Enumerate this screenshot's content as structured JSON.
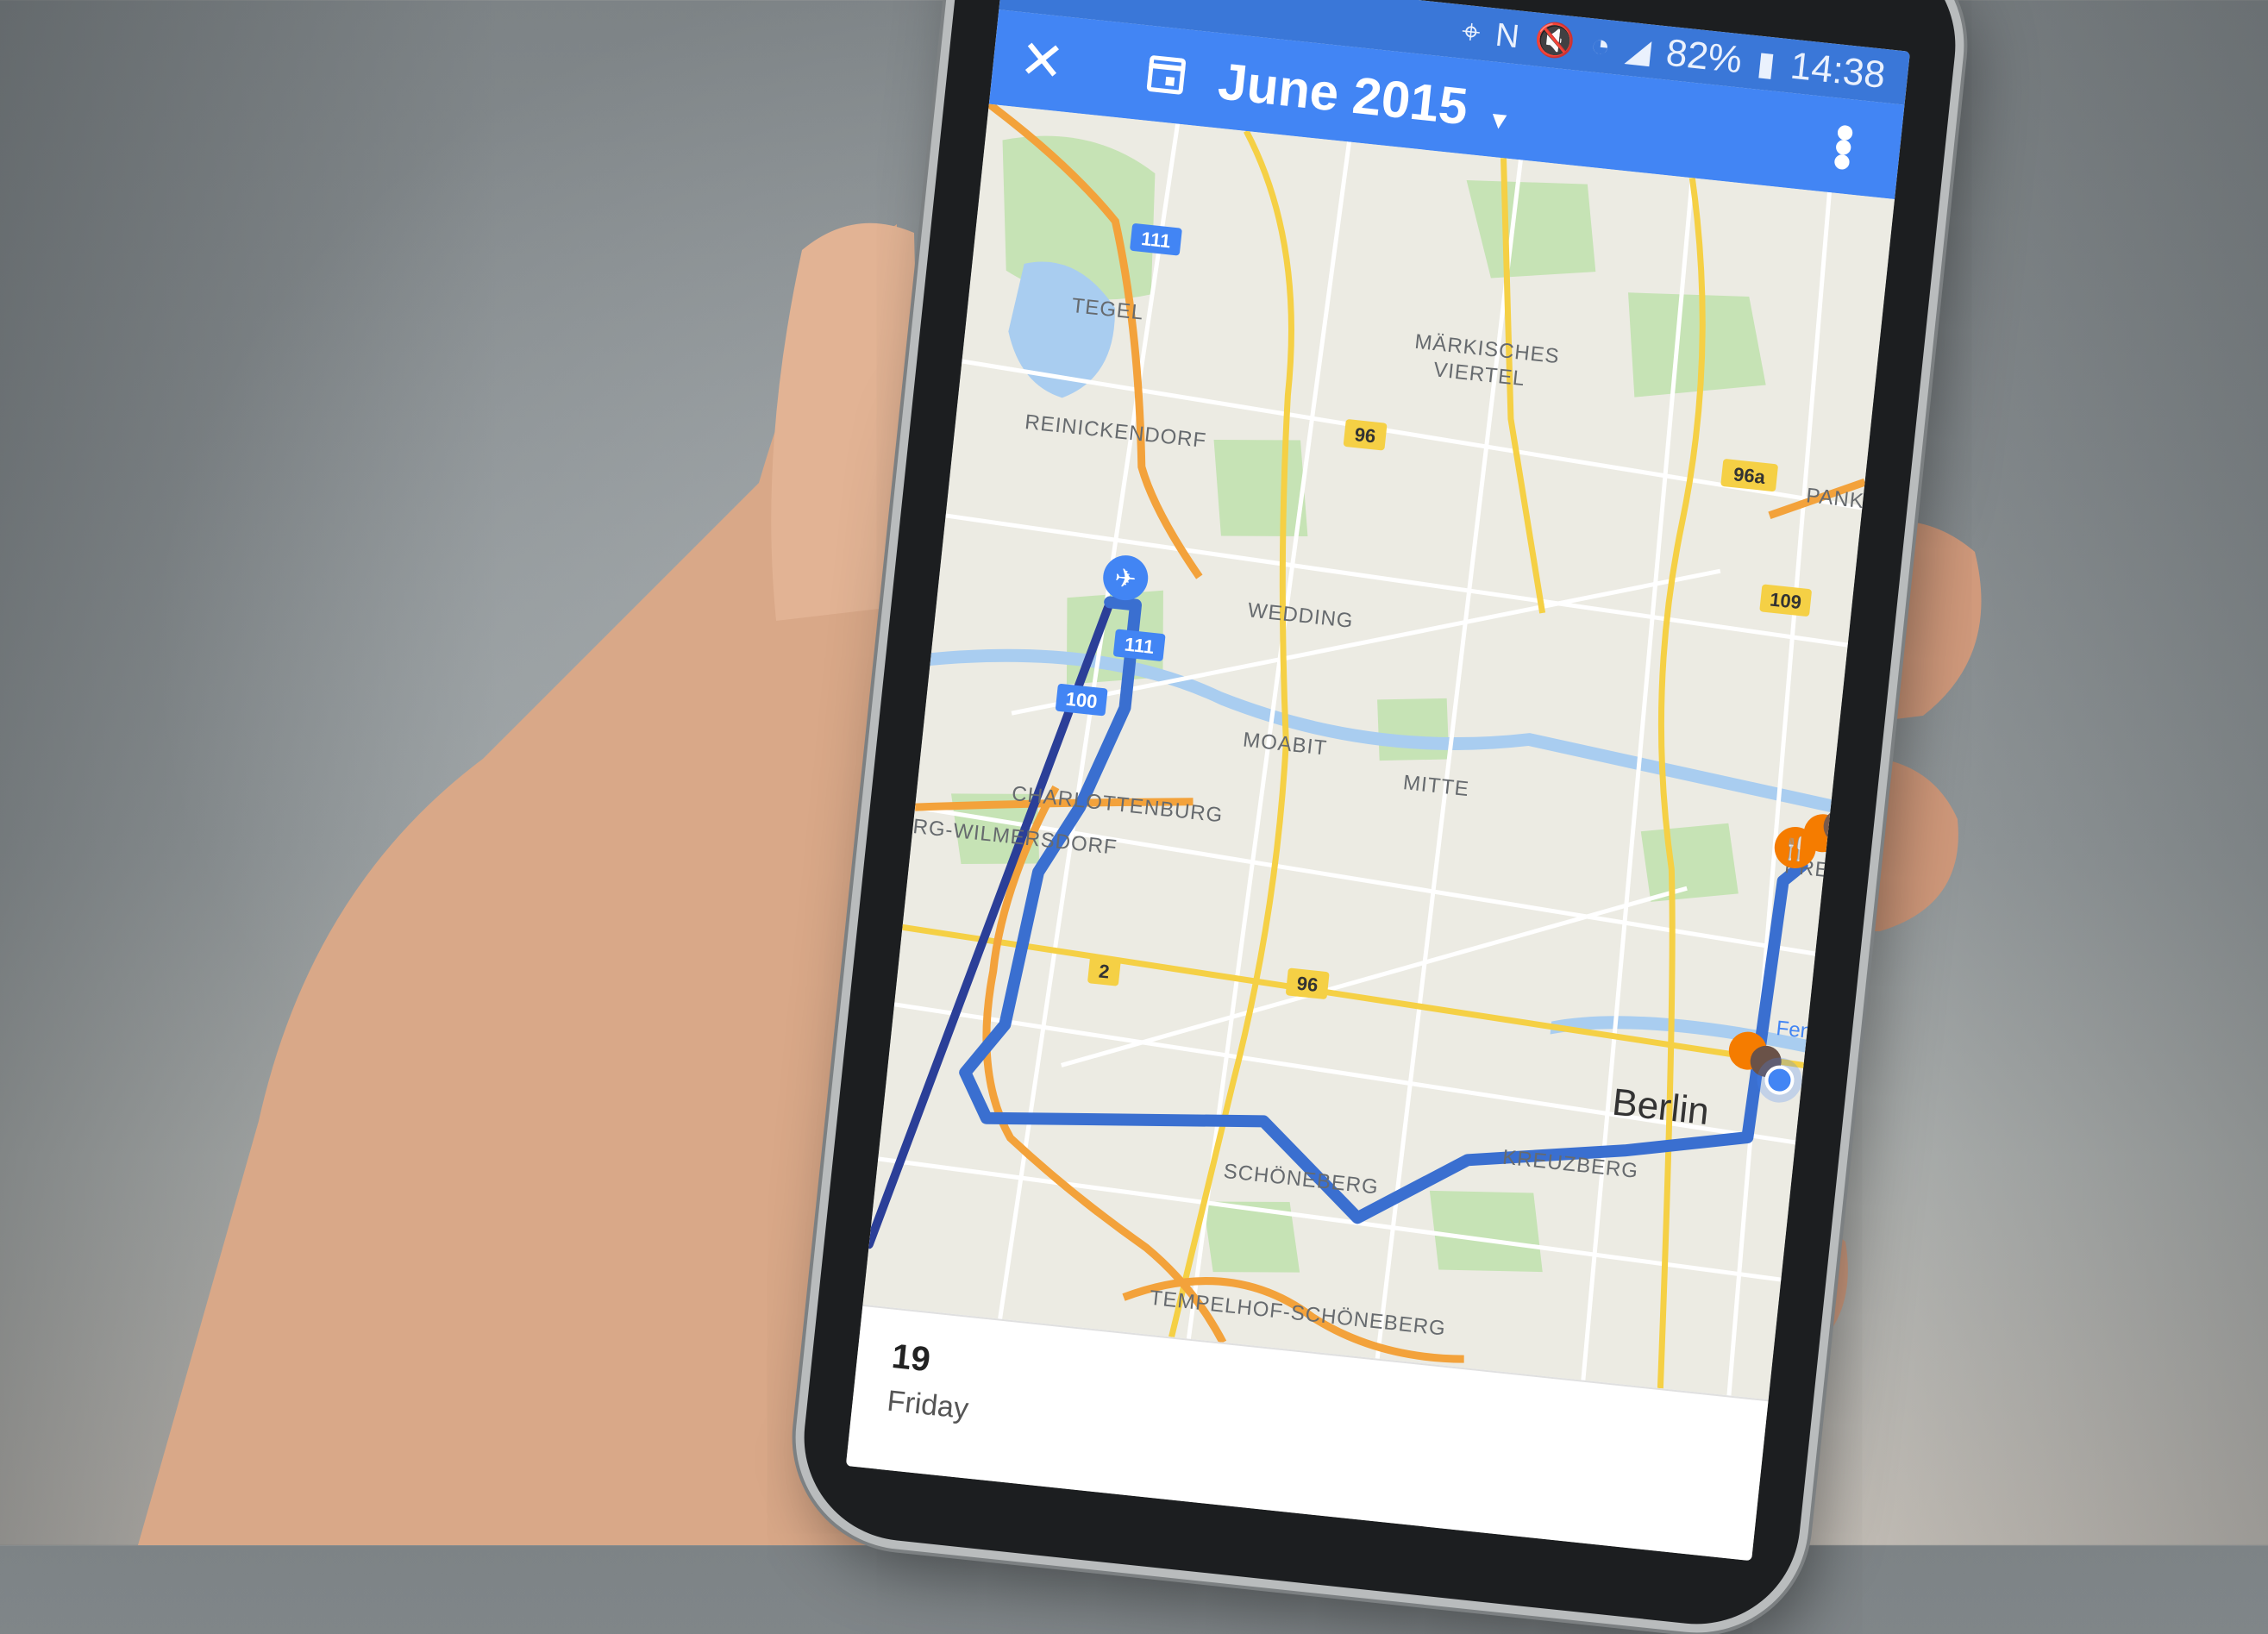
{
  "status_bar": {
    "icons": [
      "location-icon",
      "nfc-icon",
      "mute-icon",
      "wifi-icon",
      "signal-icon"
    ],
    "battery": "82%",
    "time": "14:38"
  },
  "app_bar": {
    "close_icon": "✕",
    "month_label": "June 2015",
    "dropdown_icon": "▾",
    "more_icon": "⋮"
  },
  "map": {
    "areas": [
      "TEGEL",
      "REINICKENDORF",
      "MÄRKISCHES",
      "VIERTEL",
      "PANK",
      "WEDDING",
      "MOABIT",
      "MITTE",
      "CHARLOTTENBURG",
      "RG-WILMERSDORF",
      "KREUZBERG",
      "SCHÖNEBERG",
      "TEMPELHOF-SCHÖNEBERG",
      "PRE"
    ],
    "city": "Berlin",
    "road_numbers": [
      "111",
      "96",
      "96a",
      "109",
      "111",
      "100",
      "96",
      "2"
    ],
    "poi_label": "Fenpit AG"
  },
  "day": {
    "date": "19",
    "weekday": "Friday"
  },
  "colors": {
    "appbar": "#4285f4",
    "route": "#3a6fd0",
    "route_dark": "#2b3f98",
    "highway": "#f3a23b",
    "road_yellow": "#f5d045"
  }
}
